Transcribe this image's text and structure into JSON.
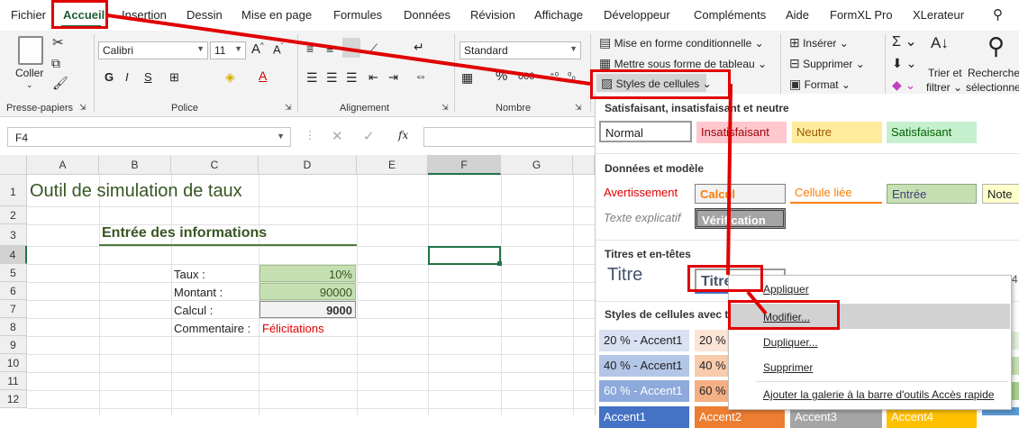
{
  "menu": [
    "Fichier",
    "Accueil",
    "Insertion",
    "Dessin",
    "Mise en page",
    "Formules",
    "Données",
    "Révision",
    "Affichage",
    "Développeur",
    "Compléments",
    "Aide",
    "FormXL Pro",
    "XLerateur"
  ],
  "ribbon": {
    "clipboard": {
      "paste_label": "Coller",
      "group_label": "Presse-papiers"
    },
    "font": {
      "font_name": "Calibri",
      "font_size": "11",
      "bold": "G",
      "italic": "I",
      "underline": "S",
      "group_label": "Police"
    },
    "alignment": {
      "group_label": "Alignement"
    },
    "number": {
      "format": "Standard",
      "percent": "%",
      "thousands": "000",
      "group_label": "Nombre"
    },
    "styles": {
      "conditional": "Mise en forme conditionnelle",
      "table": "Mettre sous forme de tableau",
      "cell_styles": "Styles de cellules"
    },
    "cells": {
      "insert": "Insérer",
      "delete": "Supprimer",
      "format": "Format"
    },
    "editing": {
      "sort_filter_1": "Trier et",
      "sort_filter_2": "filtrer",
      "find_select": "Rechercher",
      "find_select_2": "sélectionne"
    }
  },
  "formula_bar": {
    "name_box": "F4",
    "fx": "fx",
    "formula": ""
  },
  "sheet": {
    "columns": [
      "A",
      "B",
      "C",
      "D",
      "E",
      "F",
      "G"
    ],
    "rows": [
      "1",
      "2",
      "3",
      "4",
      "5",
      "6",
      "7",
      "8",
      "9",
      "10",
      "11",
      "12"
    ],
    "title": "Outil de simulation de taux",
    "section_header": "Entrée des informations",
    "labels": [
      "Taux :",
      "Montant :",
      "Calcul :",
      "Commentaire :"
    ],
    "values": {
      "taux": "10%",
      "montant": "90000",
      "calcul": "9000",
      "commentaire": "Félicitations"
    }
  },
  "panel": {
    "sections": [
      "Satisfaisant, insatisfaisant et neutre",
      "Données et modèle",
      "Titres et en-têtes",
      "Styles de cellules avec t"
    ],
    "good_bad": [
      "Normal",
      "Insatisfaisant",
      "Neutre",
      "Satisfaisant"
    ],
    "data_model_1": [
      "Avertissement",
      "Calcul",
      "Cellule liée",
      "Entrée",
      "Note"
    ],
    "data_model_2": [
      "Texte explicatif",
      "Vérification"
    ],
    "titles": [
      "Titre",
      "Titre 1"
    ],
    "accent": [
      [
        "20 % - Accent1",
        "20 %"
      ],
      [
        "40 % - Accent1",
        "40 %"
      ],
      [
        "60 % - Accent1",
        "60 %"
      ],
      [
        "Accent1",
        "Accent2",
        "Accent3",
        "Accent4"
      ]
    ],
    "partial_digit": "4"
  },
  "context_menu": {
    "items": [
      "Appliquer",
      "Modifier...",
      "Dupliquer...",
      "Supprimer",
      "Ajouter la galerie à la barre d'outils Accès rapide"
    ]
  },
  "colors": {
    "accent_green": "#217346",
    "highlight": "#e00000",
    "title_green": "#375623"
  }
}
